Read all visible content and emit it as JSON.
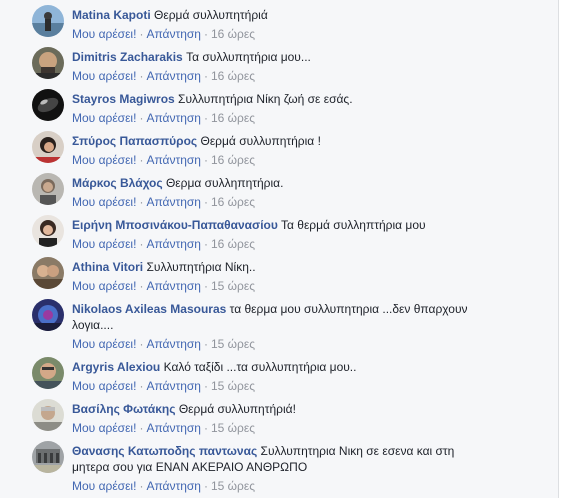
{
  "comments": [
    {
      "name": "Matina Kapoti",
      "text": "Θερμά συλλυπητήριά",
      "like": "Μου αρέσει!",
      "reply": "Απάντηση",
      "time": "16 ώρες"
    },
    {
      "name": "Dimitris Zacharakis",
      "text": "Τα συλλυπητήρια μου...",
      "like": "Μου αρέσει!",
      "reply": "Απάντηση",
      "time": "16 ώρες"
    },
    {
      "name": "Stayros Magiwros",
      "text": "Συλλυπητήρια Νίκη ζωή σε εσάς.",
      "like": "Μου αρέσει!",
      "reply": "Απάντηση",
      "time": "16 ώρες"
    },
    {
      "name": "Σπύρος Παπασπύρος",
      "text": "Θερμά συλλυπητήρια !",
      "like": "Μου αρέσει!",
      "reply": "Απάντηση",
      "time": "16 ώρες"
    },
    {
      "name": "Μάρκος Βλάχος",
      "text": "Θερμα συλληπητήρια.",
      "like": "Μου αρέσει!",
      "reply": "Απάντηση",
      "time": "16 ώρες"
    },
    {
      "name": "Ειρήνη Μποσινάκου-Παπαθανασίου",
      "text": "Τα θερμά συλληπτήρια μου",
      "like": "Μου αρέσει!",
      "reply": "Απάντηση",
      "time": "16 ώρες"
    },
    {
      "name": "Athina Vitori",
      "text": "Συλλυπητήρια Νίκη..",
      "like": "Μου αρέσει!",
      "reply": "Απάντηση",
      "time": "15 ώρες"
    },
    {
      "name": "Nikolaos Axileas Masouras",
      "text": "τα θερμα μου συλλυπητηρια ...δεν θπαρχουν λογια....",
      "like": "Μου αρέσει!",
      "reply": "Απάντηση",
      "time": "15 ώρες"
    },
    {
      "name": "Argyris Alexiou",
      "text": "Καλό ταξίδι ...τα συλλυπητήρια μου..",
      "like": "Μου αρέσει!",
      "reply": "Απάντηση",
      "time": "15 ώρες"
    },
    {
      "name": "Βασίλης Φωτάκης",
      "text": "Θερμά συλλυπητήριά!",
      "like": "Μου αρέσει!",
      "reply": "Απάντηση",
      "time": "15 ώρες"
    },
    {
      "name": "Θανασης Κατωποδης παντωνας",
      "text": "Συλλυπητηρια Νικη σε εσενα και στη μητερα σου για ΕΝΑΝ ΑΚΕΡΑΙΟ ΑΝΘΡΩΠΟ",
      "like": "Μου αρέσει!",
      "reply": "Απάντηση",
      "time": "15 ώρες"
    }
  ]
}
